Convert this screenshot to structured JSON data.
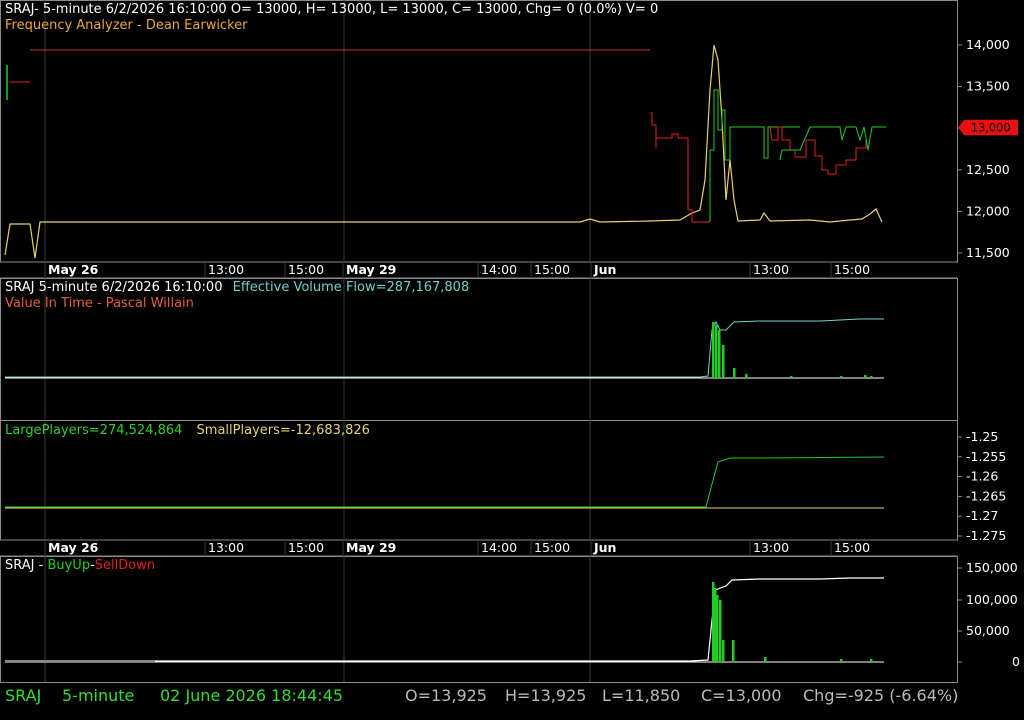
{
  "colors": {
    "bg": "#000000",
    "grid": "#3a3a3a",
    "border": "#8a8a8a",
    "green": "#22cc22",
    "red": "#e02020",
    "yellow": "#e8d070",
    "cyan": "#6fd0d0",
    "orange": "#e08a1e",
    "white": "#ffffff",
    "status_green": "#33dd33",
    "status_grey": "#bbbbbb"
  },
  "panel1": {
    "header": "SRAJ- 5-minute 6/2/2026 16:10:00 O= 13000, H= 13000, L= 13000, C= 13000, Chg= 0 (0.0%) V= 0",
    "indicator": "Frequency Analyzer - Dean Earwicker",
    "last_price_label": "13,000",
    "y_ticks": [
      "14,000",
      "13,500",
      "13,000",
      "12,500",
      "12,000",
      "11,500"
    ]
  },
  "time_axis": {
    "labels": [
      {
        "text": "May 26",
        "bold": true
      },
      {
        "text": "13:00",
        "bold": false
      },
      {
        "text": "15:00",
        "bold": false
      },
      {
        "text": "May 29",
        "bold": true
      },
      {
        "text": "14:00",
        "bold": false
      },
      {
        "text": "15:00",
        "bold": false
      },
      {
        "text": "Jun",
        "bold": true
      },
      {
        "text": "13:00",
        "bold": false
      },
      {
        "text": "15:00",
        "bold": false
      }
    ]
  },
  "panel2": {
    "header_prefix": "SRAJ 5-minute  6/2/2026 16:10:00",
    "header_value": "Effective Volume Flow=287,167,808",
    "indicator": "Value In Time - Pascal Willain"
  },
  "panel3": {
    "large": "LargePlayers=274,524,864",
    "small": "SmallPlayers=-12,683,826",
    "y_ticks": [
      "-1.25",
      "-1.255",
      "-1.26",
      "-1.265",
      "-1.27",
      "-1.275"
    ]
  },
  "panel4": {
    "header_a": "SRAJ - ",
    "header_b": "BuyUp",
    "header_c": "-",
    "header_d": "SellDown",
    "y_ticks": [
      "150,000",
      "100,000",
      "50,000",
      "0"
    ]
  },
  "status": {
    "symbol": "SRAJ",
    "interval": "5-minute",
    "datetime": "02 June 2026 18:44:45",
    "open": "O=13,925",
    "high": "H=13,925",
    "low": "L=11,850",
    "close": "C=13,000",
    "change": "Chg=-925 (-6.64%)"
  },
  "chart_data": [
    {
      "type": "line",
      "series": [
        {
          "values": [
            11850,
            11850,
            11860,
            11860,
            11870,
            11870,
            11870,
            11880,
            11890,
            11880,
            11860,
            13950,
            11850,
            11850,
            11900,
            11870,
            11880,
            11890,
            11870,
            11870,
            11890,
            11950,
            11880
          ]
        }
      ],
      "y_lim": [
        11400,
        14100
      ],
      "last_value": 13000
    },
    {
      "type": "line",
      "last_value": 287167808
    },
    {
      "type": "line",
      "y_lim": [
        -1.278,
        -1.247
      ]
    },
    {
      "type": "bar",
      "y_lim": [
        0,
        160000
      ],
      "max_bar": 130000,
      "line_end": 132000
    }
  ]
}
